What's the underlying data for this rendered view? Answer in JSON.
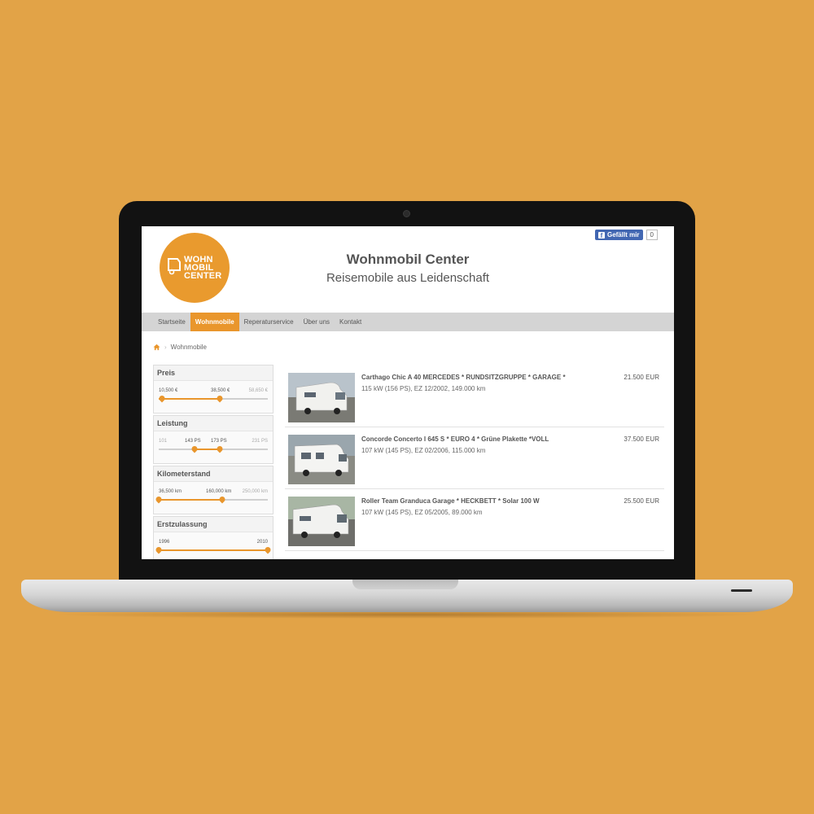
{
  "facebook": {
    "like_label": "Gefällt mir",
    "count": "0"
  },
  "logo": {
    "line1": "WOHN",
    "line2": "MOBIL",
    "line3": "CENTER"
  },
  "header": {
    "title": "Wohnmobil Center",
    "subtitle": "Reisemobile aus Leidenschaft"
  },
  "nav": [
    "Startseite",
    "Wohnmobile",
    "Reperaturservice",
    "Über uns",
    "Kontakt"
  ],
  "active_nav": "Wohnmobile",
  "breadcrumb": {
    "current": "Wohnmobile"
  },
  "filters": [
    {
      "title": "Preis",
      "min_label": "10,500 €",
      "low_label": "38,500 €",
      "max_label": "58,650 €"
    },
    {
      "title": "Leistung",
      "min_label": "101",
      "low_label": "143 PS",
      "high_label": "173 PS",
      "max_label": "231 PS"
    },
    {
      "title": "Kilometerstand",
      "min_label": "36,500 km",
      "low_label": "160,000 km",
      "max_label": "250,000 km"
    },
    {
      "title": "Erstzulassung",
      "min_label": "1996",
      "max_label": "2010"
    }
  ],
  "listings": [
    {
      "title": "Carthago Chic A 40 MERCEDES * RUNDSITZGRUPPE * GARAGE *",
      "meta": "115 kW (156 PS), EZ 12/2002, 149.000 km",
      "price": "21.500 EUR"
    },
    {
      "title": "Concorde Concerto I 645 S * EURO 4 * Grüne Plakette *VOLL",
      "meta": "107 kW (145 PS), EZ 02/2006, 115.000 km",
      "price": "37.500 EUR"
    },
    {
      "title": "Roller Team Granduca Garage * HECKBETT * Solar 100 W",
      "meta": "107 kW (145 PS), EZ 05/2005, 89.000 km",
      "price": "25.500 EUR"
    }
  ],
  "colors": {
    "background": "#e2a347",
    "accent": "#e9962c",
    "nav_bg": "#d4d4d4"
  }
}
